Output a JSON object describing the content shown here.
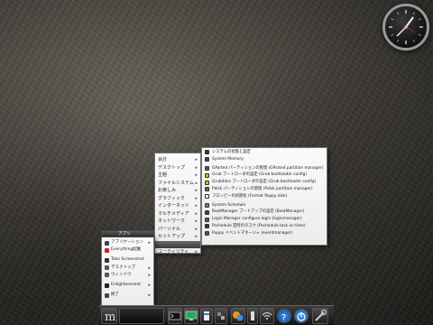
{
  "category_menu": {
    "items": [
      "会計",
      "デスクトップ",
      "主題",
      "ファイルシステム",
      "お楽しみ",
      "グラフィック",
      "インターネット",
      "マルチメディア",
      "ネットワーク",
      "パーソナル",
      "セットアップ",
      "",
      "ユーティリティ"
    ],
    "selected_index": 11
  },
  "system_menu": {
    "items": [
      {
        "label": "システムの状態と設定",
        "icon": "monitor-icon",
        "color": "#333"
      },
      {
        "label": "System Memory",
        "icon": "memory-icon",
        "color": "#444"
      },
      {
        "label": "GParted パーティションの管理 (GParted partition manager)",
        "icon": "disk-icon",
        "color": "#555"
      },
      {
        "label": "Grub ブートローダの設定 (Grub bootloader config)",
        "icon": "grub-icon",
        "color": "#c8c000"
      },
      {
        "label": "Grub4dos ブートローダの設定 (Grub bootloader config)",
        "icon": "grub4dos-icon",
        "color": "#c8c000"
      },
      {
        "label": "Pdisk パーティションの管理 (Pdisk partition manager)",
        "icon": "pdisk-icon",
        "color": "#666"
      },
      {
        "label": "フロッピーの初期化 (Format floppy disk)",
        "icon": "floppy-icon",
        "color": "#eee"
      },
      {
        "label": "System Schedule",
        "icon": "clock-icon",
        "color": "#777"
      },
      {
        "label": "BootManager ブートアップの設定 (BootManager)",
        "icon": "bootmanager-icon",
        "color": "#444"
      },
      {
        "label": "Login Manager configure login (loginmanager)",
        "icon": "login-icon",
        "color": "#555"
      },
      {
        "label": "Pschedule 定時のタスク (Pschedule task on time)",
        "icon": "schedule-icon",
        "color": "#333"
      },
      {
        "label": "Puppy イベントマネージャ (eventmanager)",
        "icon": "event-icon",
        "color": "#555"
      }
    ]
  },
  "main_menu": {
    "header": "アプリ",
    "items": [
      {
        "label": "アプリケーション",
        "icon": "apps-icon",
        "color": "#444",
        "arrow": "▸"
      },
      {
        "label": "Everything起動",
        "icon": "launch-icon",
        "color": "#c22",
        "arrow": ""
      },
      {
        "label": "",
        "icon": "",
        "color": "",
        "arrow": ""
      },
      {
        "label": "Take Screenshot",
        "icon": "screenshot-icon",
        "color": "#333",
        "arrow": ""
      },
      {
        "label": "デスクトップ",
        "icon": "desktop-icon",
        "color": "#555",
        "arrow": "▸"
      },
      {
        "label": "ウィンドウ",
        "icon": "window-icon",
        "color": "#555",
        "arrow": "▸"
      },
      {
        "label": "",
        "icon": "",
        "color": "",
        "arrow": ""
      },
      {
        "label": "Enlightenment",
        "icon": "e-icon",
        "color": "#222",
        "arrow": "▸"
      },
      {
        "label": "",
        "icon": "",
        "color": "",
        "arrow": ""
      },
      {
        "label": "終了",
        "icon": "exit-icon",
        "color": "#444",
        "arrow": "▸"
      }
    ]
  },
  "taskbar": {
    "items": [
      "start-e-icon",
      "desktop-pager-icon",
      "terminal-icon",
      "monitor-icon",
      "volume-icon",
      "photo-icon",
      "network-icon",
      "wifi-icon",
      "help-icon",
      "power-icon",
      "tools-icon"
    ]
  }
}
